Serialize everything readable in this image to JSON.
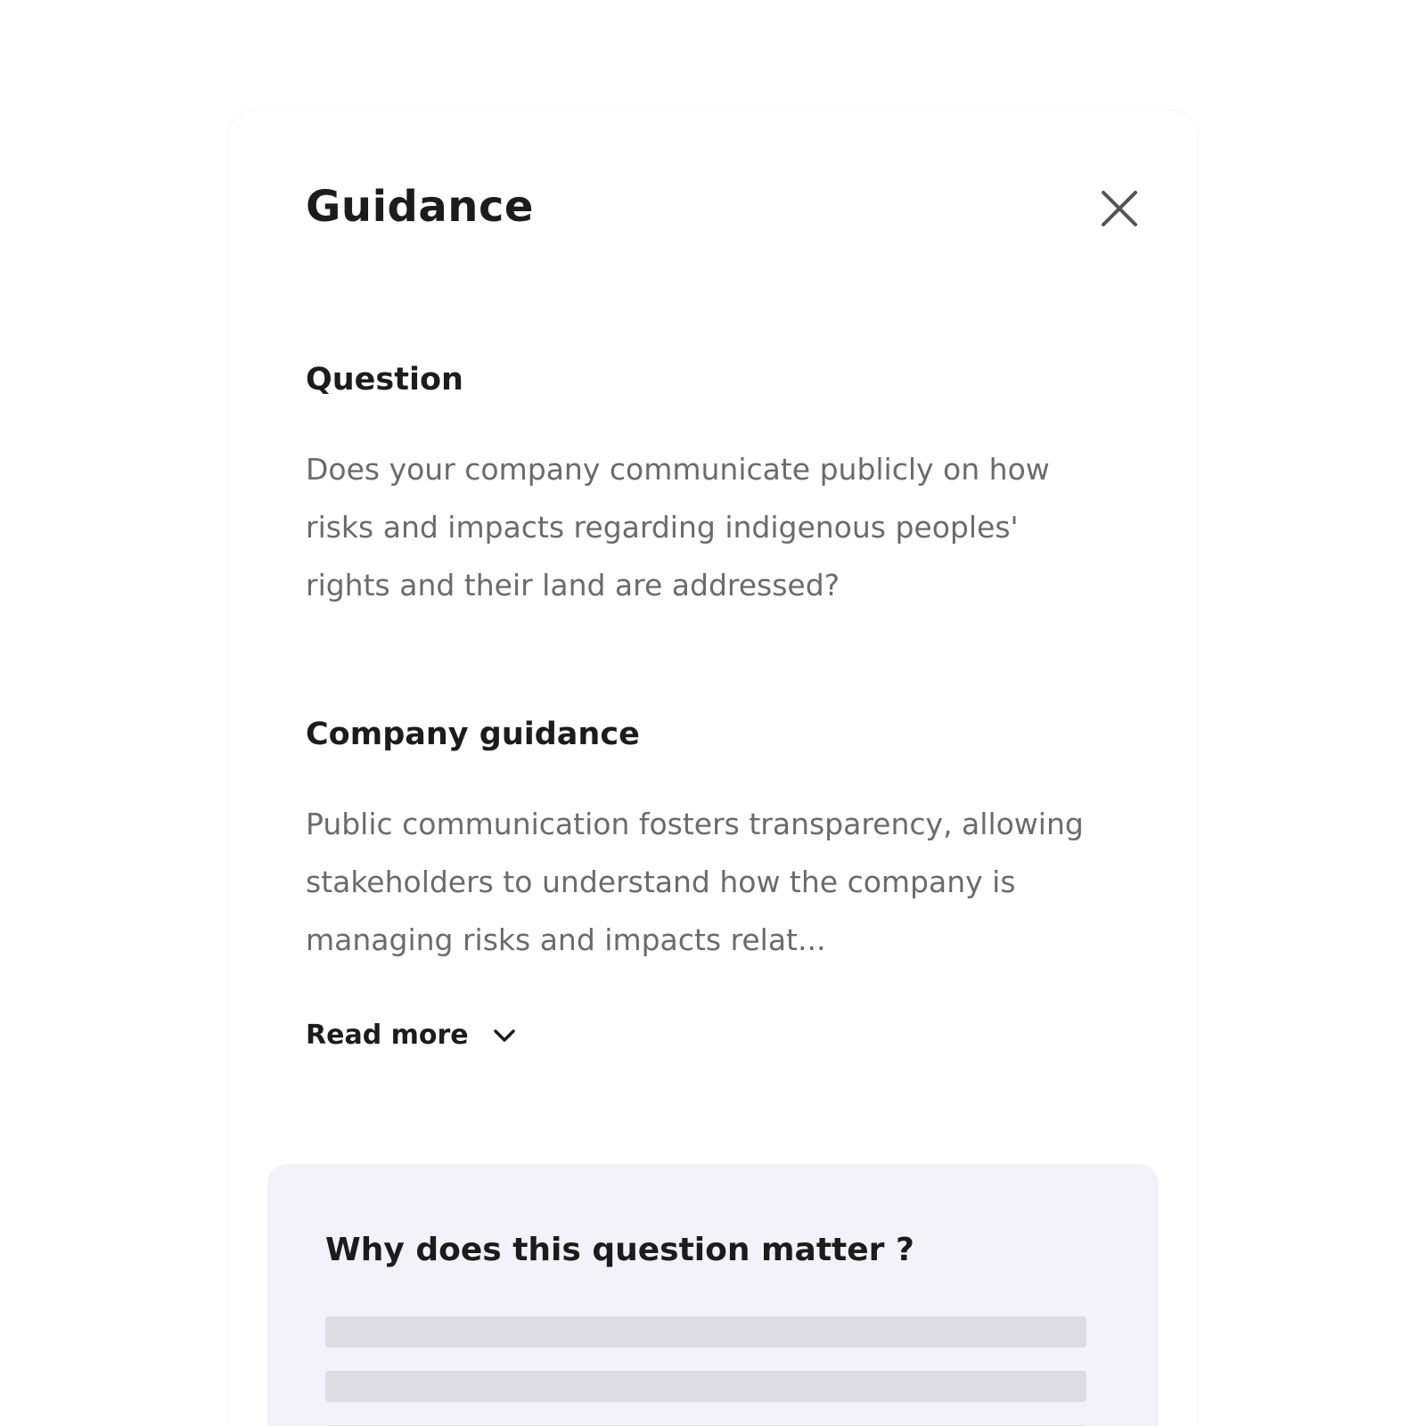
{
  "dialog": {
    "title": "Guidance",
    "close_icon": "close-icon"
  },
  "question": {
    "label": "Question",
    "text": "Does your company communicate publicly on how risks and impacts regarding indigenous peoples' rights and their land are addressed?"
  },
  "company_guidance": {
    "label": "Company guidance",
    "text": "Public communication fosters transparency, allowing stakeholders to understand how the company is managing risks and impacts relat...",
    "read_more_label": "Read more",
    "read_more_icon": "chevron-down-icon"
  },
  "why_matters": {
    "title": "Why does this question matter ?",
    "content_state": "loading-skeleton"
  },
  "colors": {
    "heading": "#1c1c1c",
    "body_text": "#6b6b6b",
    "info_box_bg": "#f3f2fb",
    "skeleton": "#dcdce2"
  }
}
